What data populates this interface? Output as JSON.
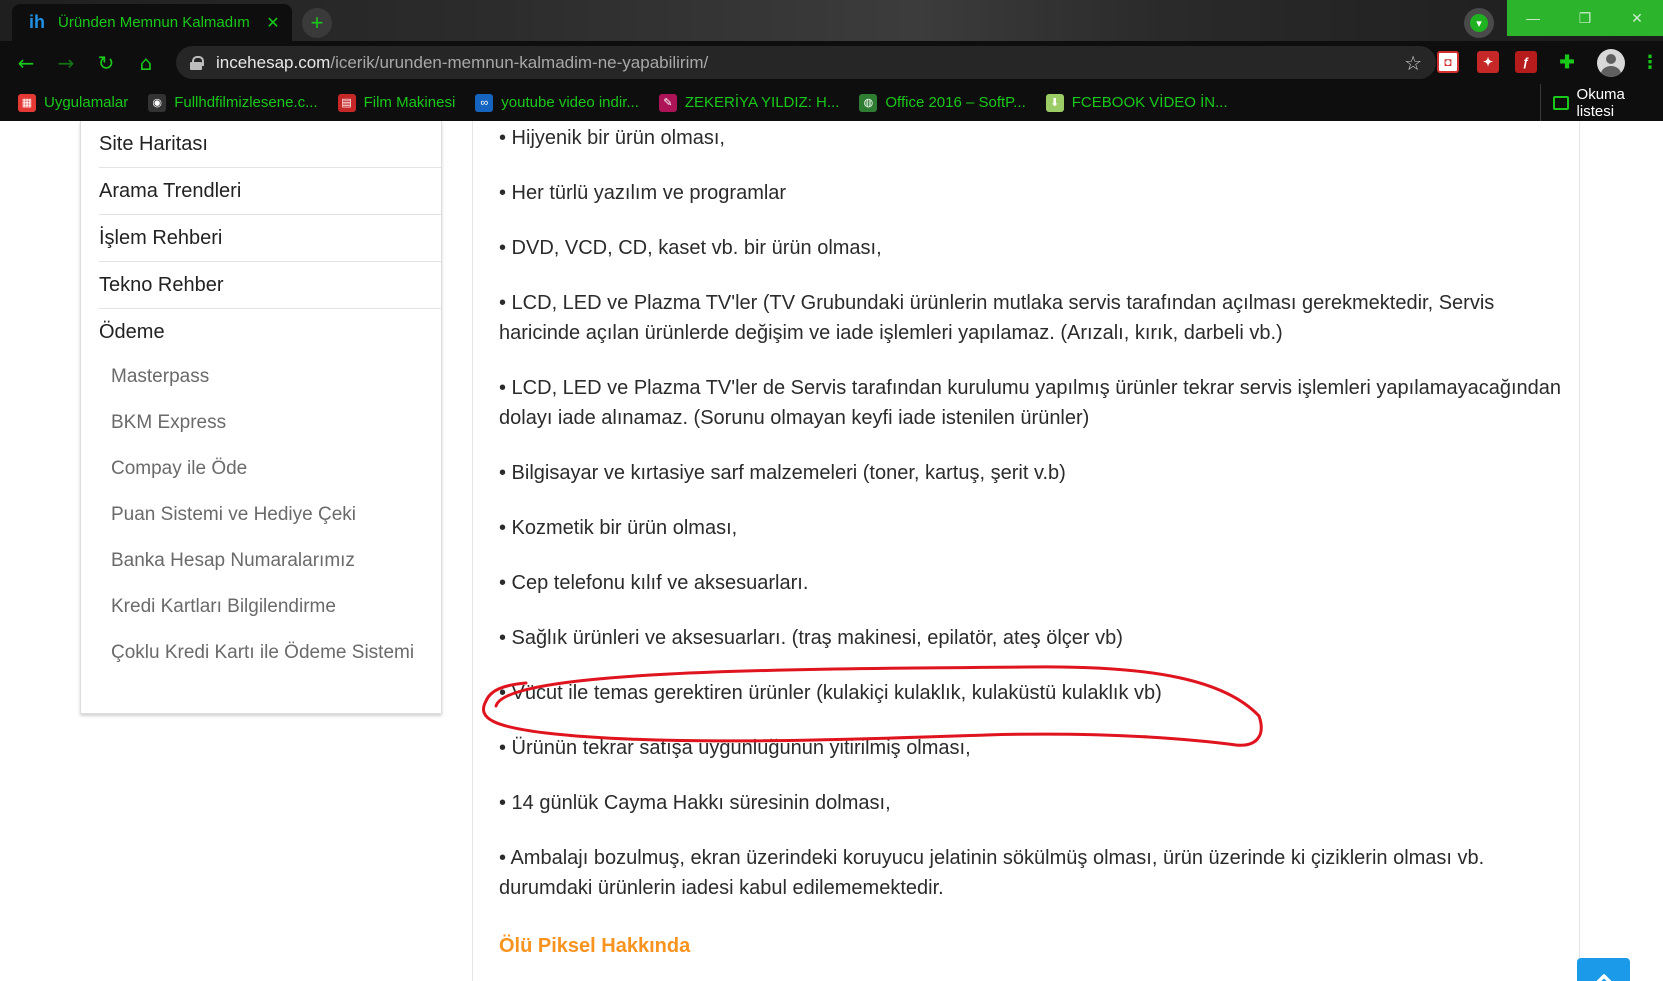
{
  "browser": {
    "tab_title": "Üründen Memnun Kalmadım Ne",
    "tab_favicon": "ih",
    "tab_close": "✕",
    "new_tab": "+",
    "url_domain": "incehesap.com",
    "url_path": "/icerik/urunden-memnun-kalmadim-ne-yapabilirim/",
    "nav": {
      "back": "←",
      "forward": "→",
      "reload": "↻",
      "home": "⌂"
    },
    "window_controls": {
      "minimize": "—",
      "maximize": "❐",
      "close": "✕"
    },
    "accent_color": "#19c919"
  },
  "bookmarks": [
    {
      "label": "Uygulamalar",
      "icon": "apps-grid-icon",
      "color": "#e53935"
    },
    {
      "label": "Fullhdfilmizlesene.c...",
      "icon": "film-reel-icon",
      "color": "#333333"
    },
    {
      "label": "Film Makinesi",
      "icon": "film-strip-icon",
      "color": "#c62828"
    },
    {
      "label": "youtube video indir...",
      "icon": "infinity-icon",
      "color": "#1565c0"
    },
    {
      "label": "ZEKERİYA YILDIZ: H...",
      "icon": "blog-icon",
      "color": "#ad1457"
    },
    {
      "label": "Office 2016 – SoftP...",
      "icon": "globe-icon",
      "color": "#2e7d32"
    },
    {
      "label": "FCEBOOK VİDEO İN...",
      "icon": "download-arrow-icon",
      "color": "#9ccc65"
    }
  ],
  "reading_list": "Okuma listesi",
  "sidebar": {
    "main_items": [
      "Site Haritası",
      "Arama Trendleri",
      "İşlem Rehberi",
      "Tekno Rehber",
      "Ödeme"
    ],
    "sub_items": [
      "Masterpass",
      "BKM Express",
      "Compay ile Öde",
      "Puan Sistemi ve Hediye Çeki",
      "Banka Hesap Numaralarımız",
      "Kredi Kartları Bilgilendirme",
      "Çoklu Kredi Kartı ile Ödeme Sistemi"
    ]
  },
  "content": {
    "paragraphs": [
      "• Hijyenik bir ürün olması,",
      "• Her türlü yazılım ve programlar",
      "• DVD, VCD, CD, kaset vb. bir ürün olması,",
      "• LCD, LED ve Plazma TV'ler (TV Grubundaki ürünlerin mutlaka servis tarafından açılması gerekmektedir, Servis haricinde açılan ürünlerde değişim ve iade işlemleri yapılamaz. (Arızalı, kırık, darbeli  vb.)",
      "• LCD, LED ve Plazma TV'ler de Servis tarafından kurulumu yapılmış ürünler tekrar servis işlemleri yapılamayacağından dolayı iade alınamaz. (Sorunu olmayan keyfi iade istenilen ürünler)",
      "• Bilgisayar ve kırtasiye sarf malzemeleri (toner, kartuş, şerit v.b)",
      "• Kozmetik bir ürün olması,",
      "• Cep telefonu kılıf ve aksesuarları.",
      "• Sağlık ürünleri ve aksesuarları. (traş makinesi, epilatör, ateş ölçer vb)",
      "• Vücut ile temas gerektiren ürünler (kulakiçi kulaklık, kulaküstü kulaklık vb)",
      "• Ürünün tekrar satışa uygunluğunun yitirilmiş olması,",
      "• 14 günlük Cayma Hakkı süresinin dolması,",
      "• Ambalajı bozulmuş, ekran üzerindeki koruyucu jelatinin sökülmüş olması, ürün üzerinde ki çiziklerin olması vb. durumdaki ürünlerin iadesi kabul edilememektedir."
    ],
    "section_heading": "Ölü Piksel Hakkında",
    "heading_color": "#f7931e",
    "annotation_color": "#e0141e"
  },
  "back_to_top_color": "#1a9ae8"
}
